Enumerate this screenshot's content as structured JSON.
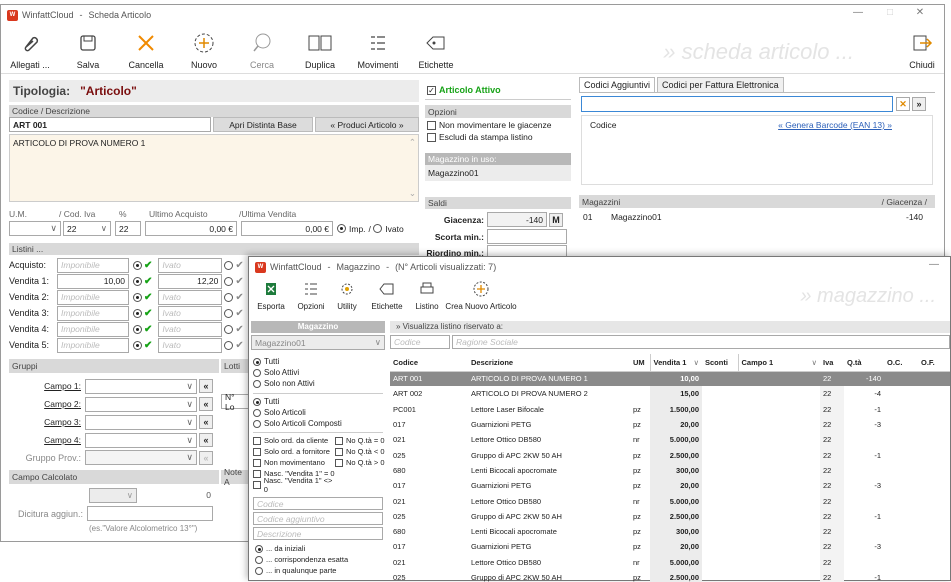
{
  "main": {
    "app": "WinfattCloud",
    "sep": "-",
    "title": "Scheda Articolo",
    "toolbar": [
      "Allegati ...",
      "Salva",
      "Cancella",
      "Nuovo",
      "Cerca",
      "Duplica",
      "Movimenti",
      "Etichette"
    ],
    "close_label": "Chiudi",
    "watermark": "» scheda articolo ...",
    "tipologia_label": "Tipologia:",
    "tipologia_value": "\"Articolo\"",
    "codice_hdr": "Codice  /  Descrizione",
    "codice": "ART 001",
    "btn_distinta": "Apri Distinta Base",
    "btn_produci": "« Produci Articolo »",
    "descrizione": "ARTICOLO DI PROVA NUMERO 1",
    "articolo_attivo": "Articolo Attivo",
    "opzioni_hdr": "Opzioni",
    "opt1": "Non movimentare le giacenze",
    "opt2": "Escludi da stampa listino",
    "magazzino_uso_hdr": "Magazzino in uso:",
    "magazzino_uso": "Magazzino01",
    "um_hdr": "U.M.",
    "codiva_hdr": "/ Cod. Iva",
    "perc_hdr": "%",
    "ua_hdr": "Ultimo Acquisto",
    "uv_hdr": "/Ultima Vendita",
    "codiva": "22",
    "perc": "22",
    "ua": "0,00 €",
    "uv": "0,00 €",
    "imp": "Imp.",
    "ivato": "Ivato",
    "saldi_hdr": "Saldi",
    "giacenza_label": "Giacenza:",
    "giacenza": "-140",
    "m_btn": "M",
    "scorta_label": "Scorta min.:",
    "riordino_label": "Riordino min.:",
    "listini_hdr": "Listini ...",
    "listini": [
      {
        "label": "Acquisto:",
        "v1": "",
        "v2": ""
      },
      {
        "label": "Vendita 1:",
        "v1": "10,00",
        "v2": "12,20"
      },
      {
        "label": "Vendita 2:",
        "v1": "",
        "v2": ""
      },
      {
        "label": "Vendita 3:",
        "v1": "",
        "v2": ""
      },
      {
        "label": "Vendita 4:",
        "v1": "",
        "v2": ""
      },
      {
        "label": "Vendita 5:",
        "v1": "",
        "v2": ""
      }
    ],
    "ph_imponibile": "Imponibile",
    "ph_ivato": "Ivato",
    "gruppi_hdr": "Gruppi",
    "campi": [
      "Campo 1:",
      "Campo 2:",
      "Campo 3:",
      "Campo 4:"
    ],
    "gruppo_prov": "Gruppo Prov.:",
    "lotti_hdr": "Lotti",
    "lotti_val": "N° Lo",
    "campo_calc_hdr": "Campo Calcolato",
    "calc_val": "0",
    "dicitura": "Dicitura aggiun.:",
    "es_alc": "(es.\"Valore Alcolometrico 13°\")",
    "note_hdr": "Note A",
    "tabs": [
      "Codici Aggiuntivi",
      "Codici per Fattura Elettronica"
    ],
    "codice_col": "Codice",
    "genera_barcode": "« Genera Barcode (EAN 13) »",
    "magazzini_hdr": "Magazzini",
    "giacenza_hdr": "/ Giacenza /",
    "mag_row": {
      "n": "01",
      "name": "Magazzino01",
      "val": "-140"
    }
  },
  "popup": {
    "app": "WinfattCloud",
    "sep": "-",
    "title": "Magazzino",
    "count": "(N° Articoli visualizzati: 7)",
    "toolbar": [
      "Esporta",
      "Opzioni",
      "Utility",
      "Etichette",
      "Listino",
      "Crea Nuovo Articolo"
    ],
    "watermark": "» magazzino ...",
    "mag_hdr": "Magazzino",
    "mag_sel": "Magazzino01",
    "radio1": [
      "Tutti",
      "Solo Attivi",
      "Solo non Attivi"
    ],
    "radio2": [
      "Tutti",
      "Solo Articoli",
      "Solo Articoli Composti"
    ],
    "filters": [
      [
        "Solo ord. da cliente",
        "No Q.tà = 0"
      ],
      [
        "Solo ord. a fornitore",
        "No Q.tà < 0"
      ],
      [
        "Non movimentano",
        "No Q.tà > 0"
      ],
      [
        "Nasc. \"Vendita 1\" = 0",
        ""
      ],
      [
        "Nasc. \"Vendita 1\" <> 0",
        ""
      ]
    ],
    "ph_codice": "Codice",
    "ph_codagg": "Codice aggiuntivo",
    "ph_descr": "Descrizione",
    "search_mode": [
      "... da iniziali",
      "... corrispondenza esatta",
      "... in qualunque parte"
    ],
    "listino_bar": "» Visualizza listino riservato a:",
    "ph_codice2": "Codice",
    "ph_ragione": "Ragione Sociale",
    "columns": [
      "Codice",
      "Descrizione",
      "UM",
      "Vendita 1",
      "Sconti",
      "Campo 1",
      "Iva",
      "Q.tà",
      "O.C.",
      "O.F."
    ],
    "rows": [
      [
        "ART 001",
        "ARTICOLO DI PROVA NUMERO 1",
        "",
        "10,00",
        "",
        "",
        "22",
        "-140",
        "",
        ""
      ],
      [
        "ART 002",
        "ARTICOLO DI PROVA NUMERO 2",
        "",
        "15,00",
        "",
        "",
        "22",
        "-4",
        "",
        ""
      ],
      [
        "PC001",
        "Lettore Laser Bifocale",
        "pz",
        "1.500,00",
        "",
        "",
        "22",
        "-1",
        "",
        ""
      ],
      [
        "017",
        "Guarnizioni PETG",
        "pz",
        "20,00",
        "",
        "",
        "22",
        "-3",
        "",
        ""
      ],
      [
        "021",
        "Lettore Ottico DB580",
        "nr",
        "5.000,00",
        "",
        "",
        "22",
        "",
        "",
        ""
      ],
      [
        "025",
        "Gruppo di APC 2KW 50 AH",
        "pz",
        "2.500,00",
        "",
        "",
        "22",
        "-1",
        "",
        ""
      ],
      [
        "680",
        "Lenti Bicocali apocromate",
        "pz",
        "300,00",
        "",
        "",
        "22",
        "",
        "",
        ""
      ],
      [
        "017",
        "Guarnizioni PETG",
        "pz",
        "20,00",
        "",
        "",
        "22",
        "-3",
        "",
        ""
      ],
      [
        "021",
        "Lettore Ottico DB580",
        "nr",
        "5.000,00",
        "",
        "",
        "22",
        "",
        "",
        ""
      ],
      [
        "025",
        "Gruppo di APC 2KW 50 AH",
        "pz",
        "2.500,00",
        "",
        "",
        "22",
        "-1",
        "",
        ""
      ],
      [
        "680",
        "Lenti Bicocali apocromate",
        "pz",
        "300,00",
        "",
        "",
        "22",
        "",
        "",
        ""
      ],
      [
        "017",
        "Guarnizioni PETG",
        "pz",
        "20,00",
        "",
        "",
        "22",
        "-3",
        "",
        ""
      ],
      [
        "021",
        "Lettore Ottico DB580",
        "nr",
        "5.000,00",
        "",
        "",
        "22",
        "",
        "",
        ""
      ],
      [
        "025",
        "Gruppo di APC 2KW 50 AH",
        "pz",
        "2.500,00",
        "",
        "",
        "22",
        "-1",
        "",
        ""
      ]
    ]
  }
}
